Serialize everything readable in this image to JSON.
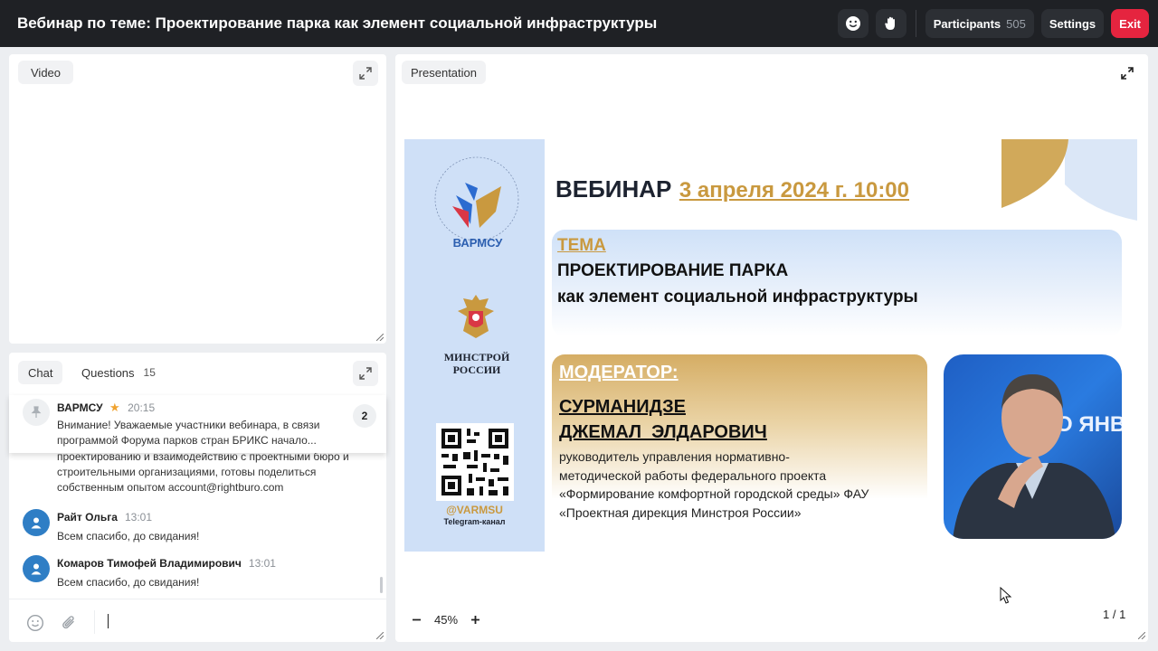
{
  "header": {
    "title": "Вебинар по теме: Проектирование парка как элемент социальной инфраструктуры",
    "participants_label": "Participants",
    "participants_count": "505",
    "settings_label": "Settings",
    "exit_label": "Exit"
  },
  "video": {
    "label": "Video"
  },
  "presentation": {
    "label": "Presentation",
    "zoom": "45%",
    "page": "1 / 1"
  },
  "chat": {
    "tab_chat": "Chat",
    "tab_questions": "Questions",
    "questions_count": "15",
    "pinned": {
      "name": "ВАРМСУ",
      "time": "20:15",
      "line1": "Внимание! Уважаемые участники вебинара, в связи",
      "line2": "программой Форума парков стран БРИКС начало...",
      "badge": "2"
    },
    "partial_lines": [
      "проектированию и взаимодействию с проектными бюро и",
      "строительными организациями, готовы поделиться",
      "собственным опытом account@rightburo.com"
    ],
    "messages": [
      {
        "name": "Райт Ольга",
        "time": "13:01",
        "text": "Всем спасибо, до свидания!"
      },
      {
        "name": "Комаров Тимофей Владимирович",
        "time": "13:01",
        "text": "Всем спасибо, до свидания!"
      }
    ]
  },
  "slide": {
    "org_name": "ВАРМСУ",
    "ministry_line1": "МИНСТРОЙ",
    "ministry_line2": "РОССИИ",
    "telegram_handle": "@VARMSU",
    "telegram_caption": "Telegram-канал",
    "webinar_word": "ВЕБИНАР",
    "date": "3 апреля 2024 г. 10:00",
    "topic_label": "ТЕМА",
    "topic_line1": "ПРОЕКТИРОВАНИЕ ПАРКА",
    "topic_line2": "как элемент социальной инфраструктуры",
    "moderator_label": "МОДЕРАТОР:",
    "moderator_surname": "СУРМАНИДЗЕ",
    "moderator_name": "ДЖЕМАЛ  ЭЛДАРОВИЧ",
    "role_line1": "руководитель управления нормативно-",
    "role_line2": "методической работы федерального проекта",
    "role_line3": "«Формирование комфортной городской среды» ФАУ",
    "role_line4": "«Проектная дирекция Минстроя России»",
    "photo_text": "О ЯНВ"
  },
  "colors": {
    "topbar": "#1f2125",
    "exit": "#e5243f",
    "avatar": "#2f7ec5",
    "slide_gold": "#c9993f"
  }
}
